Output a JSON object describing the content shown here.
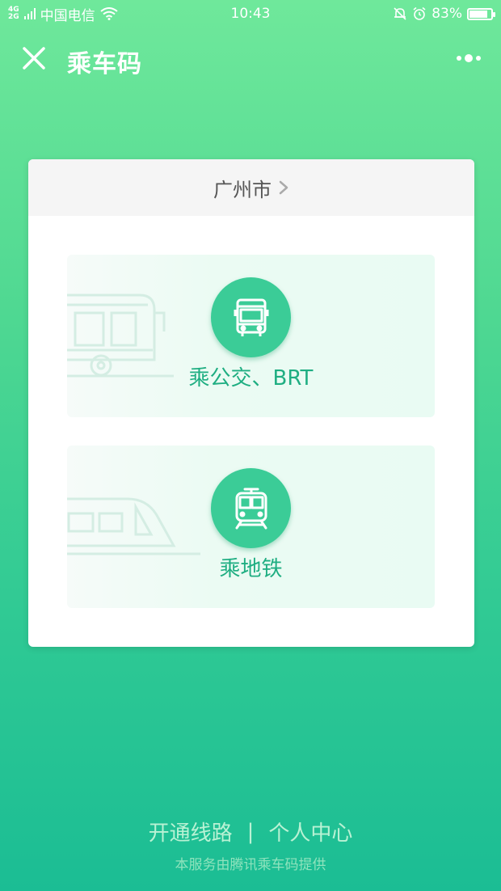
{
  "status_bar": {
    "network_type_top": "4G",
    "network_type_bottom": "2G",
    "carrier": "中国电信",
    "time": "10:43",
    "battery_percent": "83%",
    "battery_level": 0.83
  },
  "nav": {
    "title": "乘车码",
    "close_icon": "close-icon",
    "more_icon": "more-icon"
  },
  "card": {
    "city": "广州市",
    "options": [
      {
        "label": "乘公交、BRT",
        "icon": "bus-icon"
      },
      {
        "label": "乘地铁",
        "icon": "metro-icon"
      }
    ]
  },
  "footer": {
    "link_open_routes": "开通线路",
    "separator": "|",
    "link_personal_center": "个人中心",
    "note": "本服务由腾讯乘车码提供"
  },
  "colors": {
    "accent": "#3bcc97",
    "label": "#1fae82",
    "background_top": "#6fe89b",
    "background_bottom": "#1bbd94"
  }
}
